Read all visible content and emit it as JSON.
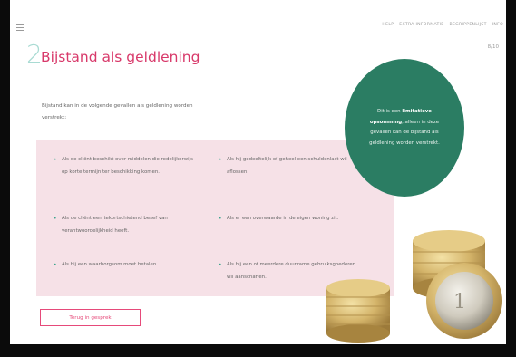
{
  "nav": {
    "items": [
      "Help",
      "Extra informatie",
      "Begrippenlijst",
      "Info"
    ]
  },
  "header": {
    "chapter_number": "2",
    "title": "Bijstand als geldlening",
    "page_counter": "8/10"
  },
  "intro": "Bijstand kan in de volgende gevallen als geldlening worden verstrekt:",
  "items": [
    "Als de cliënt beschikt over middelen die redelijkerwijs op korte termijn ter beschikking komen.",
    "Als hij gedeeltelijk of geheel een schuldenlast wil aflossen.",
    "Als de cliënt een tekortschietend besef van verantwoordelijkheid heeft.",
    "Als er een overwaarde in de eigen woning zit.",
    "Als hij een waarborgsom moet betalen.",
    "Als hij een of meerdere duurzame gebruiksgoederen wil aanschaffen."
  ],
  "callout": {
    "prefix": "Dit is een",
    "bold": "limitatieve opsomming",
    "suffix": ", alleen in deze gevallen kan de bijstand als geldlening worden verstrekt."
  },
  "back_button": "Terug in gesprek",
  "colors": {
    "accent_pink": "#e64a7a",
    "panel_pink": "#f6e1e7",
    "green": "#2b7d63",
    "chapter_mint": "#a9dbd3"
  }
}
